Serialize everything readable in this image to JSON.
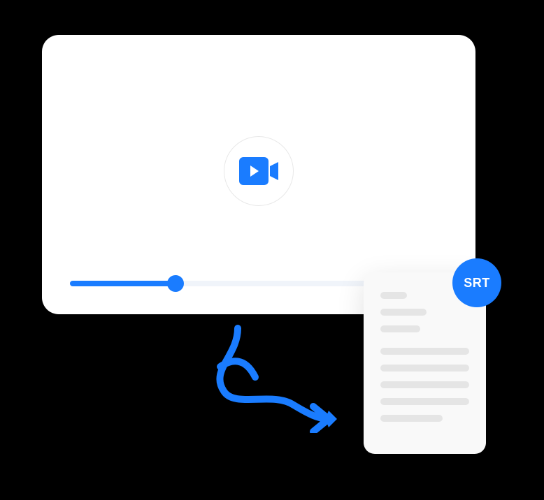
{
  "badge": {
    "label": "SRT"
  },
  "progress": {
    "percent": 28
  },
  "colors": {
    "accent": "#1a7cff",
    "background": "#000000",
    "card": "#ffffff",
    "doc": "#f9f9f9"
  }
}
